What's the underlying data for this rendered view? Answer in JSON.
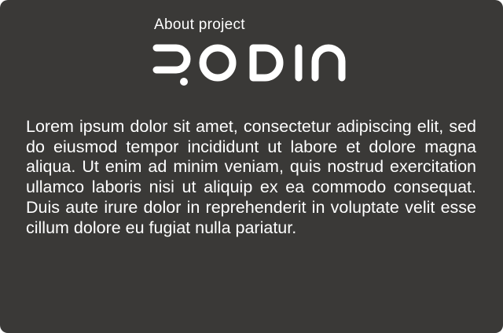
{
  "header": {
    "subtitle": "About project",
    "logo_text": "RODIN"
  },
  "main": {
    "paragraph": "Lorem ipsum dolor sit amet, consectetur adipiscing elit, sed do eiusmod tempor inci­didunt ut labore et dolore magna aliqua. Ut enim ad minim veniam, quis nostrud exercita­tion ullamco laboris nisi ut aliquip ex ea com­modo consequat. Duis aute irure dolor in rep­rehenderit in voluptate velit esse cillum dolore eu fugiat nulla pariatur."
  },
  "colors": {
    "background": "#3a3937",
    "text": "#ffffff"
  }
}
